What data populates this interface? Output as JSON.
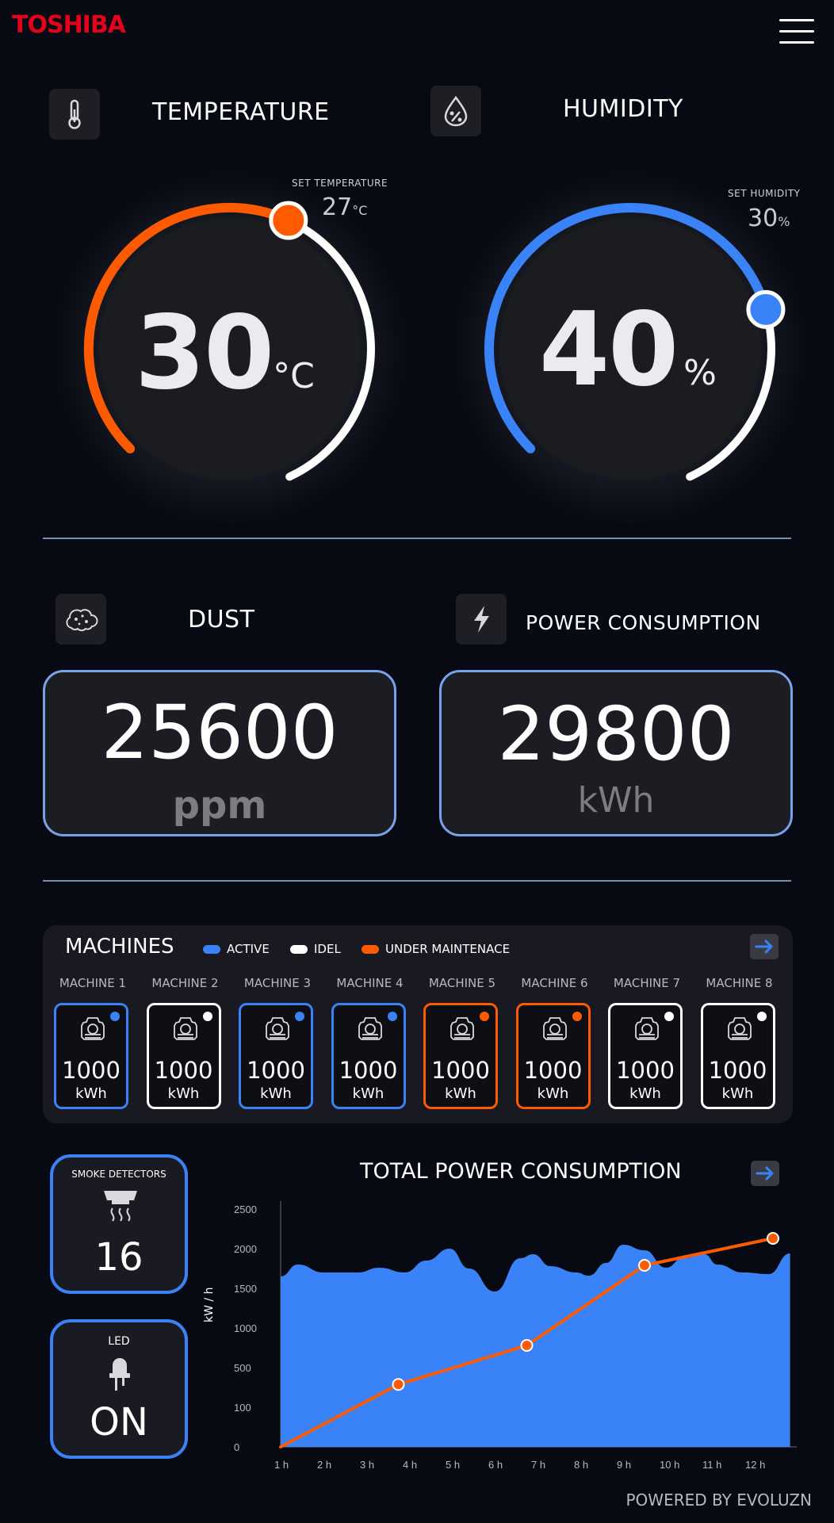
{
  "header": {
    "brand": "TOSHIBA",
    "menu_icon": "hamburger-menu-icon"
  },
  "temperature": {
    "title": "TEMPERATURE",
    "icon": "thermometer-icon",
    "set_label": "SET  TEMPERATURE",
    "set_value": "27",
    "set_unit": "°C",
    "value": "30",
    "unit": "°C",
    "level_fraction": 0.55,
    "accent": "#ff5a00"
  },
  "humidity": {
    "title": "HUMIDITY",
    "icon": "water-drop-percent-icon",
    "set_label": "SET  HUMIDITY",
    "set_value": "30",
    "set_unit": "%",
    "value": "40",
    "unit": "%",
    "level_fraction": 0.72,
    "accent": "#3a82f7"
  },
  "dust": {
    "title": "DUST",
    "icon": "dust-cloud-icon",
    "value": "25600",
    "unit": "ppm"
  },
  "power": {
    "title": "POWER CONSUMPTION",
    "icon": "lightning-bolt-icon",
    "value": "29800",
    "unit": "kWh"
  },
  "machines": {
    "title": "MACHINES",
    "legend": {
      "active": "ACTIVE",
      "idle": "IDEL",
      "maintenance": "UNDER MAINTENACE"
    },
    "colors": {
      "active": "#3a82f7",
      "idle": "#ffffff",
      "maintenance": "#ff5a00"
    },
    "items": [
      {
        "label": "MACHINE 1",
        "value": "1000",
        "unit": "kWh",
        "status": "active"
      },
      {
        "label": "MACHINE 2",
        "value": "1000",
        "unit": "kWh",
        "status": "idle"
      },
      {
        "label": "MACHINE 3",
        "value": "1000",
        "unit": "kWh",
        "status": "active"
      },
      {
        "label": "MACHINE 4",
        "value": "1000",
        "unit": "kWh",
        "status": "active"
      },
      {
        "label": "MACHINE 5",
        "value": "1000",
        "unit": "kWh",
        "status": "maintenance"
      },
      {
        "label": "MACHINE 6",
        "value": "1000",
        "unit": "kWh",
        "status": "maintenance"
      },
      {
        "label": "MACHINE 7",
        "value": "1000",
        "unit": "kWh",
        "status": "idle"
      },
      {
        "label": "MACHINE 8",
        "value": "1000",
        "unit": "kWh",
        "status": "idle"
      }
    ]
  },
  "smoke": {
    "title": "SMOKE DETECTORS",
    "icon": "smoke-detector-icon",
    "value": "16"
  },
  "led": {
    "title": "LED",
    "icon": "led-bulb-icon",
    "value": "ON"
  },
  "chart_data": {
    "type": "area",
    "title": "TOTAL POWER CONSUMPTION",
    "xlabel": "",
    "ylabel": "kW / h",
    "y_ticks": [
      "0",
      "100",
      "500",
      "1000",
      "1500",
      "2000",
      "2500"
    ],
    "x_ticks": [
      "1 h",
      "2 h",
      "3 h",
      "4 h",
      "5 h",
      "6 h",
      "7 h",
      "8 h",
      "9 h",
      "10 h",
      "11 h",
      "12 h"
    ],
    "grid": false,
    "series": [
      {
        "kind": "area",
        "color": "#3a82f7",
        "points": [
          [
            1.0,
            1650
          ],
          [
            1.4,
            1800
          ],
          [
            2.0,
            1700
          ],
          [
            2.8,
            1700
          ],
          [
            3.3,
            1760
          ],
          [
            3.9,
            1700
          ],
          [
            4.4,
            1850
          ],
          [
            4.95,
            2000
          ],
          [
            5.4,
            1750
          ],
          [
            6.0,
            1460
          ],
          [
            6.6,
            1880
          ],
          [
            6.9,
            1930
          ],
          [
            7.3,
            1780
          ],
          [
            7.9,
            1700
          ],
          [
            8.2,
            1660
          ],
          [
            8.6,
            1820
          ],
          [
            9.0,
            2050
          ],
          [
            9.5,
            1980
          ],
          [
            10.0,
            1760
          ],
          [
            10.4,
            1880
          ],
          [
            10.9,
            1930
          ],
          [
            11.2,
            1800
          ],
          [
            11.8,
            1700
          ],
          [
            12.4,
            1680
          ],
          [
            12.9,
            1940
          ]
        ]
      },
      {
        "kind": "line",
        "color": "#ff5a00",
        "points": [
          [
            1.0,
            0
          ],
          [
            3.75,
            330
          ],
          [
            6.75,
            780
          ],
          [
            9.5,
            1790
          ],
          [
            12.5,
            2130
          ]
        ],
        "markers": [
          [
            3.75,
            330
          ],
          [
            6.75,
            780
          ],
          [
            9.5,
            1790
          ],
          [
            12.5,
            2130
          ]
        ]
      }
    ]
  },
  "footer": {
    "text": "POWERED BY EVOLUZN"
  }
}
